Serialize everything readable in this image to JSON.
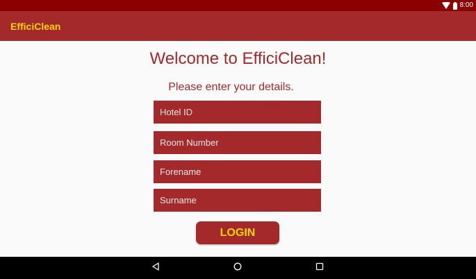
{
  "status_bar": {
    "time": "8:00",
    "icons": [
      "wifi-icon",
      "battery-icon"
    ]
  },
  "app_bar": {
    "title": "EfficiClean"
  },
  "main": {
    "welcome": "Welcome to EfficiClean!",
    "instructions": "Please enter your details.",
    "fields": {
      "hotel_id": {
        "placeholder": "Hotel ID",
        "value": ""
      },
      "room_number": {
        "placeholder": "Room Number",
        "value": ""
      },
      "forename": {
        "placeholder": "Forename",
        "value": ""
      },
      "surname": {
        "placeholder": "Surname",
        "value": ""
      }
    },
    "login_label": "LOGIN"
  },
  "nav_bar": {
    "icons": [
      "back-icon",
      "home-icon",
      "recents-icon"
    ]
  },
  "colors": {
    "status_bar": "#8b0000",
    "primary": "#a3292b",
    "accent": "#ffd700",
    "background": "#fafafa",
    "nav_bar": "#000000"
  }
}
